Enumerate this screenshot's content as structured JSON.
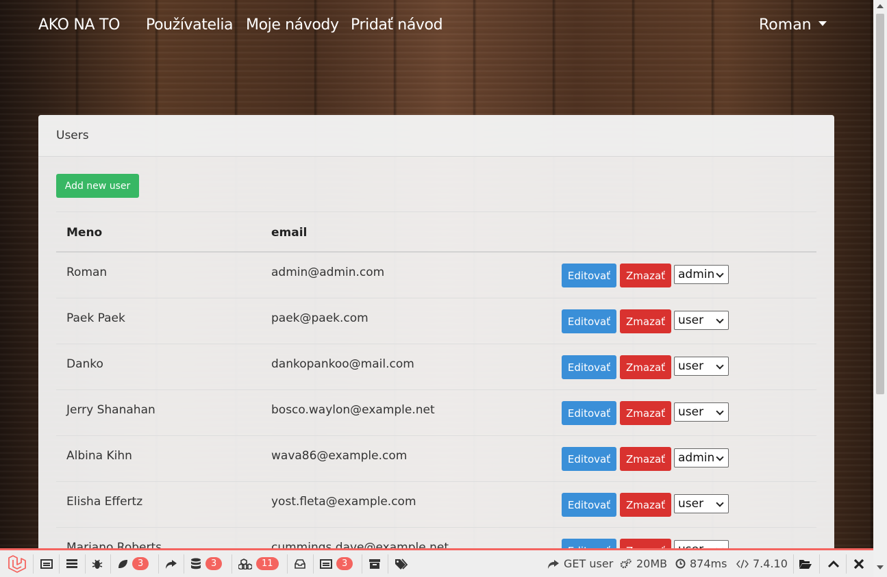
{
  "navbar": {
    "brand": "AKO NA TO",
    "links": [
      "Používatelia",
      "Moje návody",
      "Pridať návod"
    ],
    "user": "Roman"
  },
  "card": {
    "title": "Users",
    "add_button": "Add new user"
  },
  "table": {
    "headers": [
      "Meno",
      "email"
    ],
    "edit_label": "Editovať",
    "delete_label": "Zmazať",
    "rows": [
      {
        "name": "Roman",
        "email": "admin@admin.com",
        "role": "admin"
      },
      {
        "name": "Paek Paek",
        "email": "paek@paek.com",
        "role": "user"
      },
      {
        "name": "Danko",
        "email": "dankopankoo@mail.com",
        "role": "user"
      },
      {
        "name": "Jerry Shanahan",
        "email": "bosco.waylon@example.net",
        "role": "user"
      },
      {
        "name": "Albina Kihn",
        "email": "wava86@example.com",
        "role": "admin"
      },
      {
        "name": "Elisha Effertz",
        "email": "yost.fleta@example.com",
        "role": "user"
      },
      {
        "name": "Mariano Roberts",
        "email": "cummings.dave@example.net",
        "role": "user"
      }
    ]
  },
  "debugbar": {
    "badges": {
      "views": "3",
      "queries": "3",
      "models": "11",
      "gate": "3"
    },
    "request": "GET user",
    "memory": "20MB",
    "time": "874ms",
    "php_version": "7.4.10",
    "accent": "#f4645f"
  },
  "colors": {
    "edit": "#3a8fd8",
    "delete": "#d9322f",
    "add": "#38b764"
  }
}
